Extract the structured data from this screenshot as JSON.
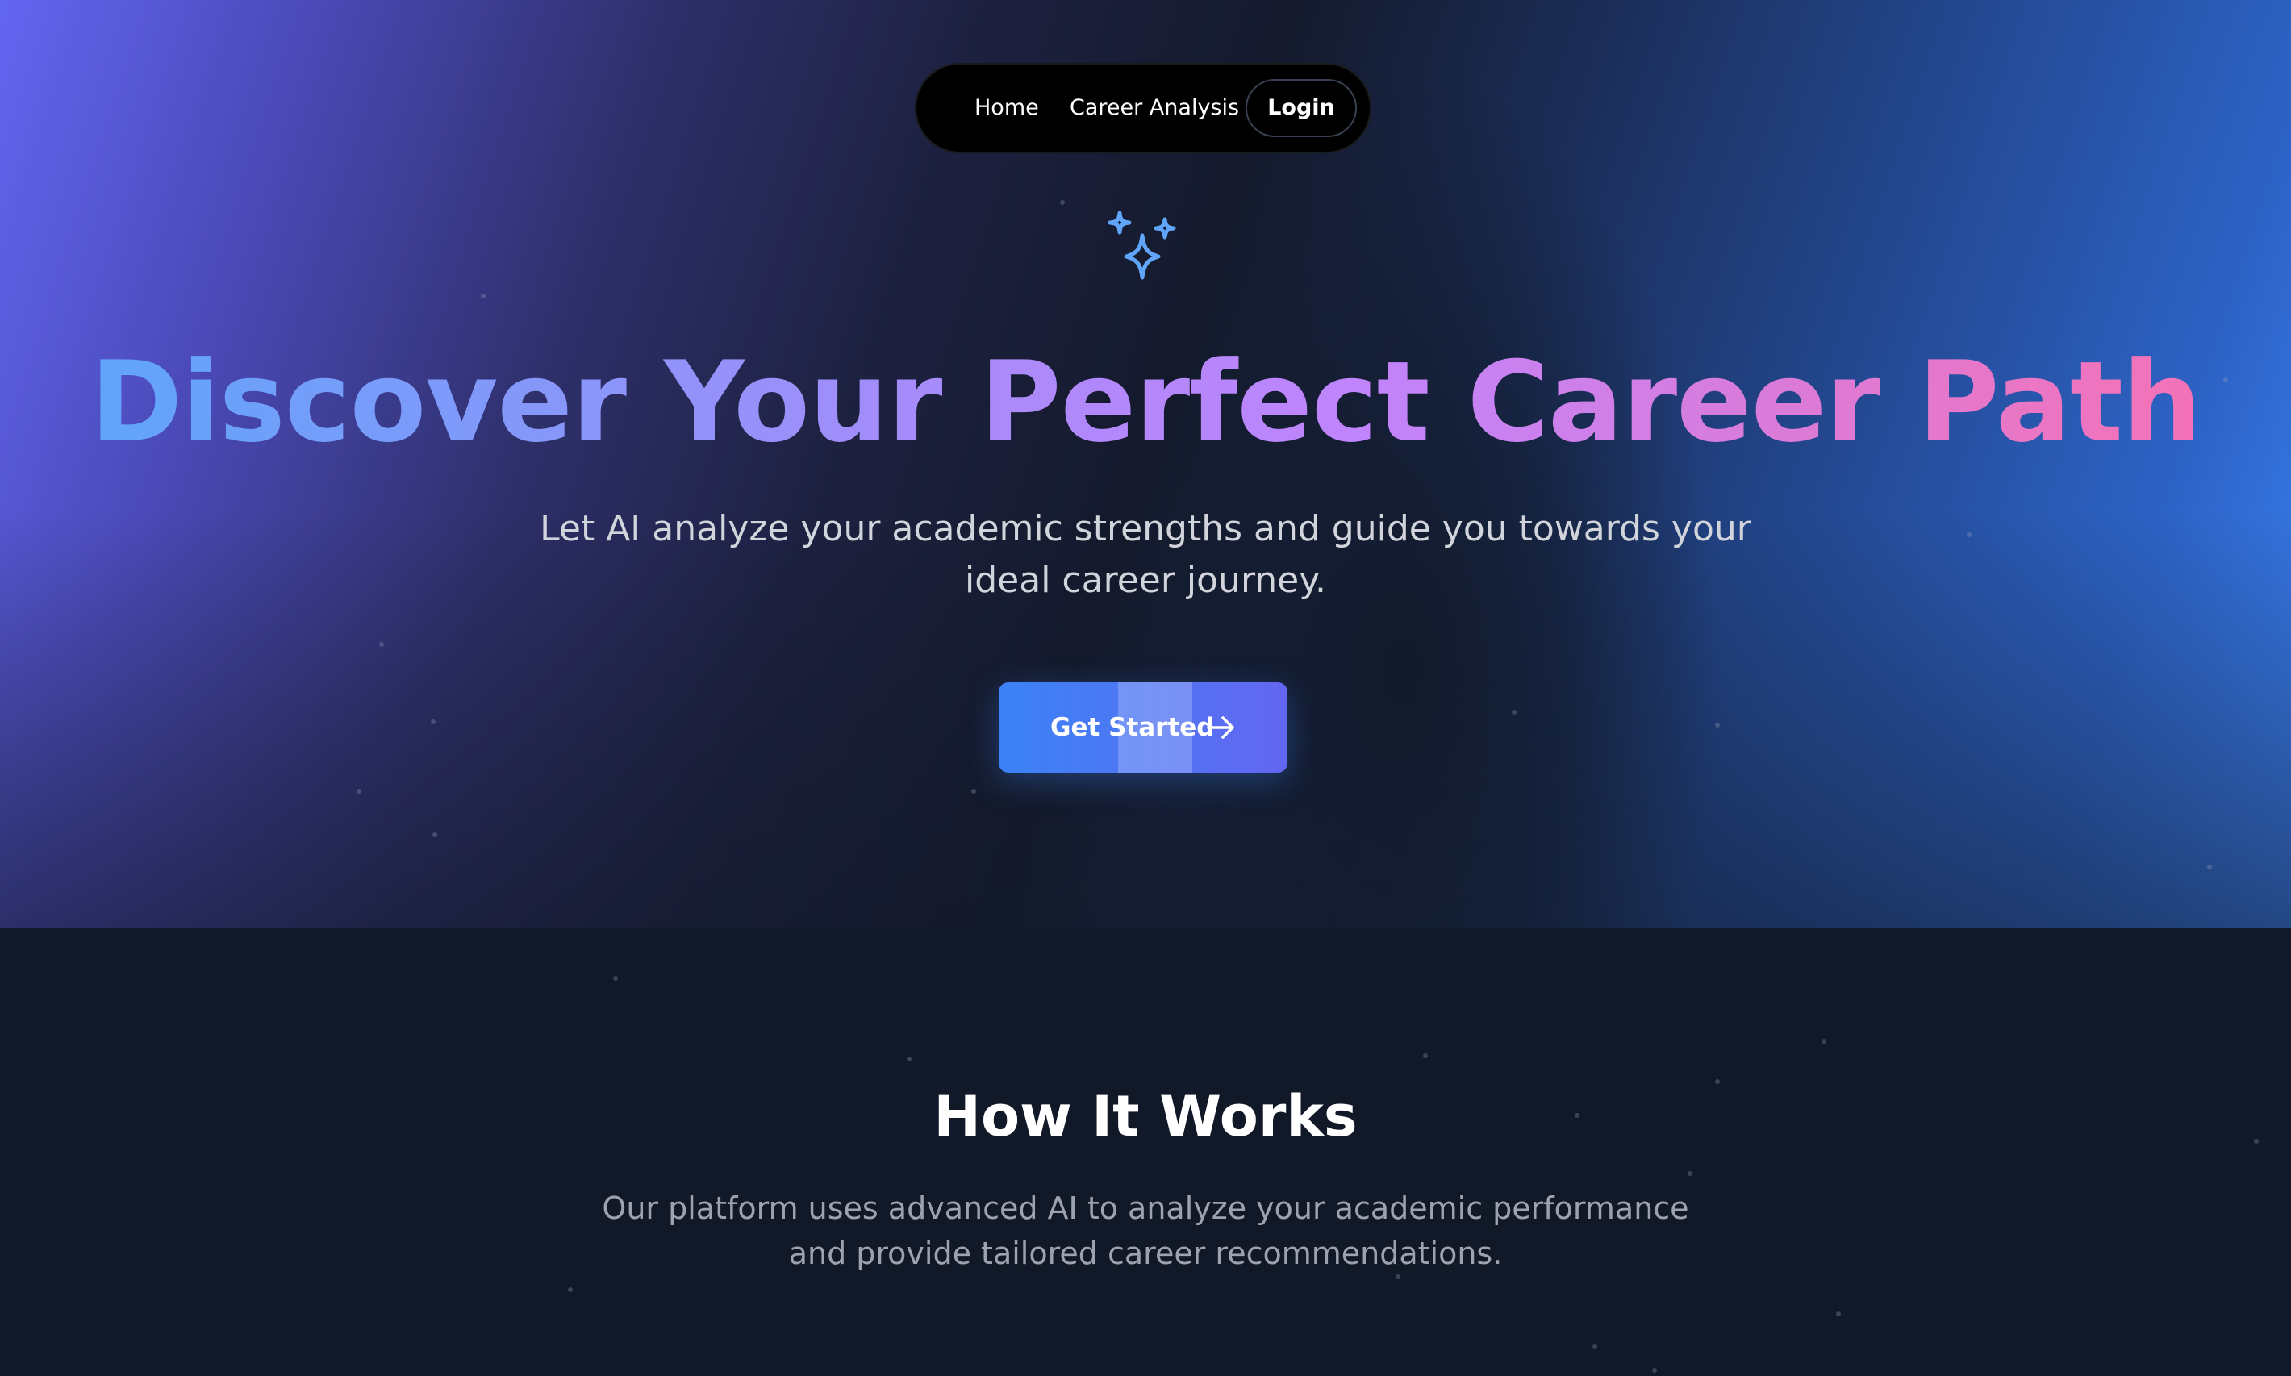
{
  "colors": {
    "hero_gradient_start": "#6366f1",
    "hero_gradient_end": "#3b82f6",
    "page_background": "#111827",
    "nav_background": "#000000",
    "title_gradient": [
      "#60a5fa",
      "#a78bfa",
      "#c084fc",
      "#f472b6"
    ],
    "button_gradient": [
      "#3b82f6",
      "#6366f1"
    ],
    "subtitle_text": "#d1d5db",
    "muted_text": "#9ca3af"
  },
  "nav": {
    "items": [
      {
        "label": "Home"
      },
      {
        "label": "Career Analysis"
      }
    ],
    "login_label": "Login"
  },
  "hero": {
    "icon": "sparkles-icon",
    "title": "Discover Your Perfect Career Path",
    "subtitle": "Let AI analyze your academic strengths and guide you towards your ideal career journey.",
    "cta_label": "Get Started",
    "cta_icon": "arrow-right-icon"
  },
  "how_it_works": {
    "title": "How It Works",
    "description": "Our platform uses advanced AI to analyze your academic performance and provide tailored career recommendations."
  }
}
